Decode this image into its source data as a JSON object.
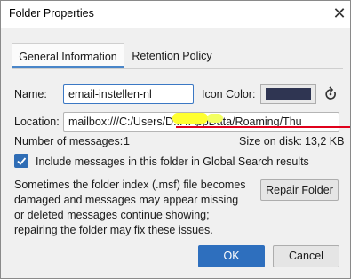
{
  "window": {
    "title": "Folder Properties"
  },
  "tabs": [
    {
      "label": "General Information"
    },
    {
      "label": "Retention Policy"
    }
  ],
  "fields": {
    "name_label": "Name:",
    "name_value": "email-instellen-nl",
    "icon_color_label": "Icon Color:",
    "icon_color": "#2f3552",
    "location_label": "Location:",
    "location_value": "mailbox:///C:/Users/D... /AppData/Roaming/Thu"
  },
  "stats": {
    "messages_label": "Number of messages:",
    "messages_value": "1",
    "size_label": "Size on disk:",
    "size_value": "13,2 KB"
  },
  "checkbox": {
    "label": "Include messages in this folder in Global Search results",
    "checked": true
  },
  "description": "Sometimes the folder index (.msf) file becomes damaged and messages may appear missing or deleted messages continue showing; repairing the folder may fix these issues.",
  "buttons": {
    "repair": "Repair Folder",
    "ok": "OK",
    "cancel": "Cancel"
  },
  "colors": {
    "accent": "#2e6fbe",
    "annotation_red": "#e0001b",
    "redaction_yellow": "#ffff30"
  }
}
